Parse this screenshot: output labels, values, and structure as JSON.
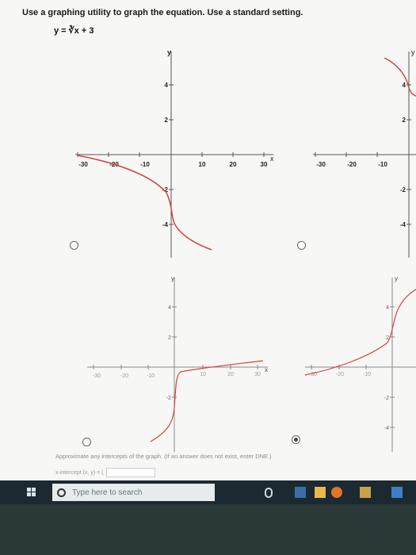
{
  "question": {
    "prompt": "Use a graphing utility to graph the equation. Use a standard setting.",
    "equation": "y = ∛x + 3"
  },
  "options": [
    {
      "y_axis_label": "y",
      "x_axis_label": "x",
      "x_ticks": [
        "-30",
        "-20",
        "-10",
        "10",
        "20",
        "30"
      ],
      "y_ticks": [
        "4",
        "2",
        "-2",
        "-4"
      ],
      "selected": false
    },
    {
      "y_axis_label": "y",
      "x_ticks": [
        "-30",
        "-20",
        "-10"
      ],
      "y_ticks": [
        "4",
        "2",
        "-2",
        "-4"
      ],
      "selected": false
    },
    {
      "y_axis_label": "y",
      "x_axis_label": "x",
      "x_ticks": [
        "-30",
        "-20",
        "-10",
        "10",
        "20",
        "30"
      ],
      "y_ticks": [
        "4",
        "2",
        "-2"
      ],
      "selected": false
    },
    {
      "y_axis_label": "y",
      "x_ticks": [
        "-30",
        "-20",
        "-10"
      ],
      "y_ticks": [
        "4",
        "2",
        "-2",
        "-4"
      ],
      "selected": true
    }
  ],
  "intercepts": {
    "instruction": "Approximate any intercepts of the graph. (If an answer does not exist, enter DNE.)",
    "x_intercept_label": "x-intercept",
    "x_intercept_format": "(x, y) = ("
  },
  "taskbar": {
    "search_placeholder": "Type here to search"
  }
}
